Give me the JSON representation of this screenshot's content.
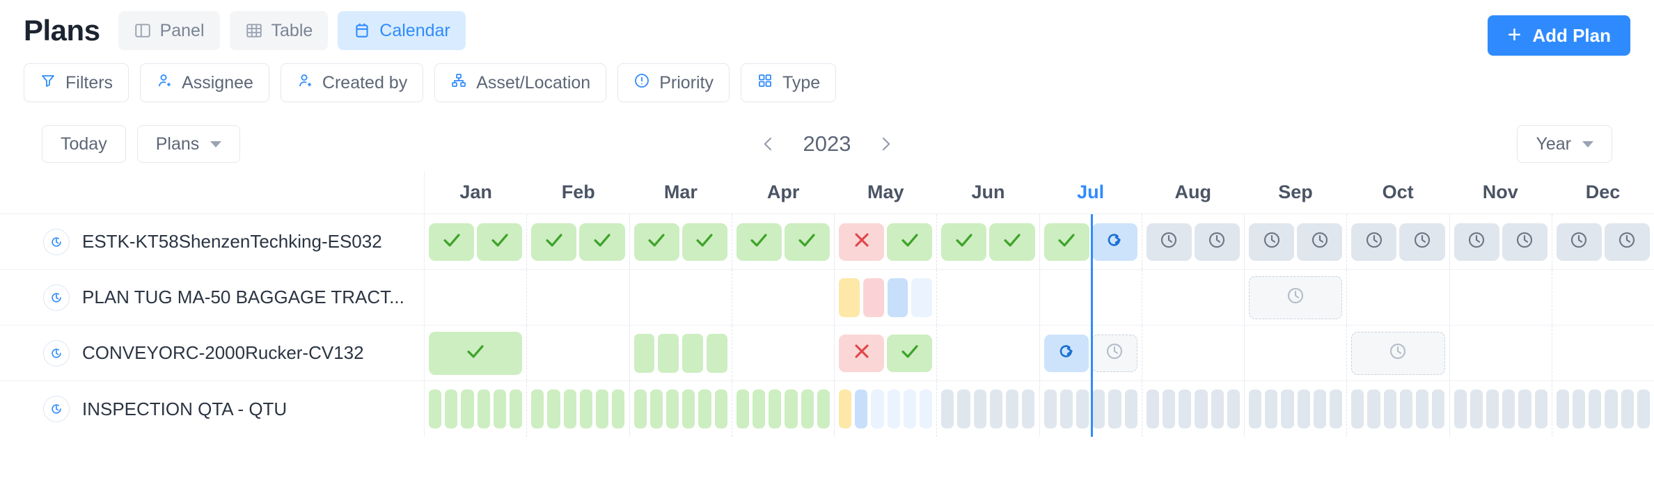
{
  "header": {
    "title": "Plans",
    "views": [
      {
        "label": "Panel",
        "icon": "panel-icon",
        "active": false
      },
      {
        "label": "Table",
        "icon": "table-icon",
        "active": false
      },
      {
        "label": "Calendar",
        "icon": "calendar-icon",
        "active": true
      }
    ],
    "add_plan_label": "Add Plan",
    "add_plan_plus": "+"
  },
  "filters": [
    {
      "label": "Filters",
      "icon": "funnel-icon"
    },
    {
      "label": "Assignee",
      "icon": "user-add-icon"
    },
    {
      "label": "Created by",
      "icon": "user-add-icon"
    },
    {
      "label": "Asset/Location",
      "icon": "hierarchy-icon"
    },
    {
      "label": "Priority",
      "icon": "exclamation-circle-icon"
    },
    {
      "label": "Type",
      "icon": "grid-squares-icon"
    }
  ],
  "toolbar": {
    "today_label": "Today",
    "group_label": "Plans",
    "prev_icon": "chevron-left-icon",
    "next_icon": "chevron-right-icon",
    "year": "2023",
    "period_label": "Year"
  },
  "calendar": {
    "months": [
      "Jan",
      "Feb",
      "Mar",
      "Apr",
      "May",
      "Jun",
      "Jul",
      "Aug",
      "Sep",
      "Oct",
      "Nov",
      "Dec"
    ],
    "current_month": "Jul",
    "today_position_percent": 50.8,
    "colors": {
      "accent": "#2f8bfd",
      "done": "#cdeec0",
      "done_mark": "#3fa32b",
      "missed": "#fbd6d6",
      "missed_mark": "#e0464a",
      "in_progress": "#cde3fb",
      "scheduled": "#e0e6ed",
      "pending_outline": "#c9d2de"
    },
    "rows": [
      {
        "name": "ESTK-KT58ShenzenTechking-ES032",
        "icon": "recurring-clock-icon",
        "months": {
          "Jan": {
            "type": "chips",
            "items": [
              {
                "state": "done"
              },
              {
                "state": "done"
              }
            ]
          },
          "Feb": {
            "type": "chips",
            "items": [
              {
                "state": "done"
              },
              {
                "state": "done"
              }
            ]
          },
          "Mar": {
            "type": "chips",
            "items": [
              {
                "state": "done"
              },
              {
                "state": "done"
              }
            ]
          },
          "Apr": {
            "type": "chips",
            "items": [
              {
                "state": "done"
              },
              {
                "state": "done"
              }
            ]
          },
          "May": {
            "type": "chips",
            "items": [
              {
                "state": "missed"
              },
              {
                "state": "done"
              }
            ]
          },
          "Jun": {
            "type": "chips",
            "items": [
              {
                "state": "done"
              },
              {
                "state": "done"
              }
            ]
          },
          "Jul": {
            "type": "chips",
            "items": [
              {
                "state": "done"
              },
              {
                "state": "in_progress"
              }
            ]
          },
          "Aug": {
            "type": "chips",
            "items": [
              {
                "state": "scheduled"
              },
              {
                "state": "scheduled"
              }
            ]
          },
          "Sep": {
            "type": "chips",
            "items": [
              {
                "state": "scheduled"
              },
              {
                "state": "scheduled"
              }
            ]
          },
          "Oct": {
            "type": "chips",
            "items": [
              {
                "state": "scheduled"
              },
              {
                "state": "scheduled"
              }
            ]
          },
          "Nov": {
            "type": "chips",
            "items": [
              {
                "state": "scheduled"
              },
              {
                "state": "scheduled"
              }
            ]
          },
          "Dec": {
            "type": "chips",
            "items": [
              {
                "state": "scheduled"
              },
              {
                "state": "scheduled"
              }
            ]
          }
        }
      },
      {
        "name": "PLAN TUG MA-50 BAGGAGE TRACT...",
        "icon": "recurring-clock-icon",
        "months": {
          "May": {
            "type": "bars",
            "items": [
              "yellow",
              "pink",
              "blue",
              "lblue"
            ]
          },
          "Sep": {
            "type": "chips",
            "items": [
              {
                "state": "pending"
              }
            ]
          }
        }
      },
      {
        "name": "CONVEYORC-2000Rucker-CV132",
        "icon": "recurring-clock-icon",
        "months": {
          "Jan": {
            "type": "chips",
            "items": [
              {
                "state": "done"
              }
            ]
          },
          "Mar": {
            "type": "bars",
            "items": [
              "green",
              "green",
              "green",
              "green"
            ]
          },
          "May": {
            "type": "chips",
            "items": [
              {
                "state": "missed"
              },
              {
                "state": "done"
              }
            ]
          },
          "Jul": {
            "type": "chips",
            "items": [
              {
                "state": "in_progress"
              },
              {
                "state": "pending"
              }
            ]
          },
          "Oct": {
            "type": "chips",
            "items": [
              {
                "state": "pending"
              }
            ]
          }
        }
      },
      {
        "name": "INSPECTION QTA - QTU",
        "icon": "recurring-clock-icon",
        "months": {
          "Jan": {
            "type": "bars",
            "items": [
              "green",
              "green",
              "green",
              "green",
              "green",
              "green"
            ]
          },
          "Feb": {
            "type": "bars",
            "items": [
              "green",
              "green",
              "green",
              "green",
              "green",
              "green"
            ]
          },
          "Mar": {
            "type": "bars",
            "items": [
              "green",
              "green",
              "green",
              "green",
              "green",
              "green"
            ]
          },
          "Apr": {
            "type": "bars",
            "items": [
              "green",
              "green",
              "green",
              "green",
              "green",
              "green"
            ]
          },
          "May": {
            "type": "bars",
            "items": [
              "yellow",
              "blue",
              "lblue",
              "lblue",
              "lblue",
              "lblue"
            ]
          },
          "Jun": {
            "type": "bars",
            "items": [
              "gray",
              "gray",
              "gray",
              "gray",
              "gray",
              "gray"
            ]
          },
          "Jul": {
            "type": "bars",
            "items": [
              "gray",
              "gray",
              "gray",
              "gray",
              "gray",
              "gray"
            ]
          },
          "Aug": {
            "type": "bars",
            "items": [
              "gray",
              "gray",
              "gray",
              "gray",
              "gray",
              "gray"
            ]
          },
          "Sep": {
            "type": "bars",
            "items": [
              "gray",
              "gray",
              "gray",
              "gray",
              "gray",
              "gray"
            ]
          },
          "Oct": {
            "type": "bars",
            "items": [
              "gray",
              "gray",
              "gray",
              "gray",
              "gray",
              "gray"
            ]
          },
          "Nov": {
            "type": "bars",
            "items": [
              "gray",
              "gray",
              "gray",
              "gray",
              "gray",
              "gray"
            ]
          },
          "Dec": {
            "type": "bars",
            "items": [
              "gray",
              "gray",
              "gray",
              "gray",
              "gray",
              "gray"
            ]
          }
        }
      }
    ]
  }
}
